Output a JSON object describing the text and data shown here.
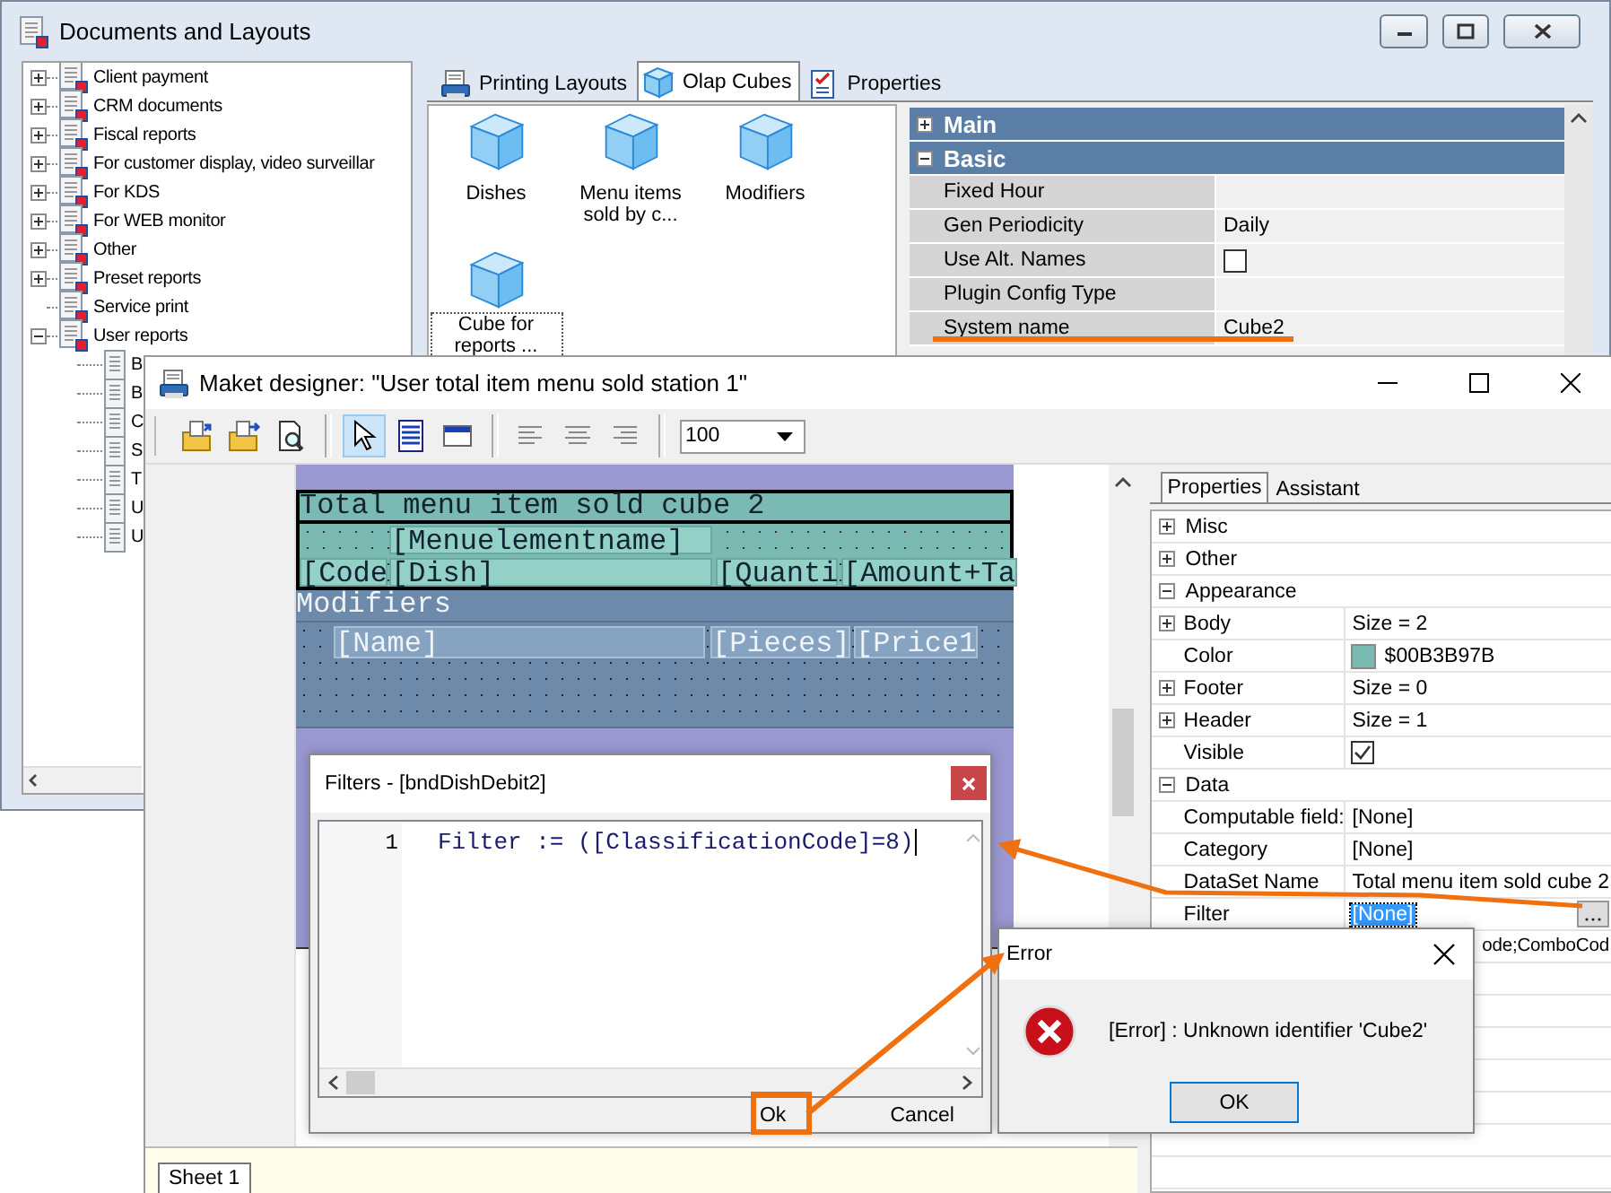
{
  "documents_window": {
    "title": "Documents and Layouts",
    "tree": [
      {
        "label": "Client payment",
        "expanded": false
      },
      {
        "label": "CRM documents",
        "expanded": false
      },
      {
        "label": "Fiscal reports",
        "expanded": false
      },
      {
        "label": "For customer display, video surveillar",
        "expanded": false
      },
      {
        "label": "For KDS",
        "expanded": false
      },
      {
        "label": "For WEB monitor",
        "expanded": false
      },
      {
        "label": "Other",
        "expanded": false
      },
      {
        "label": "Preset reports",
        "expanded": false
      },
      {
        "label": "Service print"
      },
      {
        "label": "User reports",
        "expanded": true,
        "children": [
          {
            "label": "B"
          },
          {
            "label": "B"
          },
          {
            "label": "C"
          },
          {
            "label": "S"
          },
          {
            "label": "T"
          },
          {
            "label": "U"
          },
          {
            "label": "U"
          }
        ]
      }
    ],
    "tabs": [
      {
        "label": "Printing Layouts",
        "selected": false
      },
      {
        "label": "Olap Cubes",
        "selected": true
      },
      {
        "label": "Properties",
        "selected": false
      }
    ],
    "cubes": [
      {
        "label": "Dishes",
        "selected": false
      },
      {
        "label": "Menu items sold by c...",
        "selected": false
      },
      {
        "label": "Modifiers",
        "selected": false
      },
      {
        "label": "Cube for reports ...",
        "selected": true
      }
    ],
    "property_grid": [
      {
        "kind": "section",
        "label": "Main",
        "expanded": false
      },
      {
        "kind": "section",
        "label": "Basic",
        "expanded": true
      },
      {
        "kind": "text",
        "label": "Fixed Hour"
      },
      {
        "kind": "text",
        "label": "Gen Periodicity",
        "value": "Daily"
      },
      {
        "kind": "checkbox",
        "label": "Use Alt. Names",
        "checked": false
      },
      {
        "kind": "text",
        "label": "Plugin Config Type"
      },
      {
        "kind": "text",
        "label": "System name",
        "value": "Cube2"
      }
    ]
  },
  "designer_window": {
    "title": "Maket designer: \"User total item menu sold station 1\"",
    "toolbar": [
      {
        "kind": "open",
        "selected": false
      },
      {
        "kind": "save",
        "selected": false
      },
      {
        "kind": "preview",
        "selected": false
      },
      {
        "kind": "pointer",
        "selected": true
      },
      {
        "kind": "band",
        "selected": false
      },
      {
        "kind": "frame",
        "selected": false
      },
      {
        "kind": "align_left",
        "selected": false
      },
      {
        "kind": "align_center",
        "selected": false
      },
      {
        "kind": "align_right",
        "selected": false
      }
    ],
    "zoom": "100",
    "bands": [
      {
        "kind": "header",
        "text": "Total menu item sold cube 2"
      },
      {
        "kind": "master",
        "fields": [
          "[Menuelementname]",
          "[Code",
          "[Dish]",
          "[Quanti",
          "[Amount+Ta"
        ]
      },
      {
        "kind": "group_header",
        "text": "Modifiers"
      },
      {
        "kind": "detail",
        "fields": [
          "[Name]",
          "[Pieces]",
          "[Price1"
        ]
      }
    ],
    "panel_tabs": [
      {
        "label": "Properties",
        "selected": true
      },
      {
        "label": "Assistant",
        "selected": false
      }
    ],
    "properties": [
      {
        "kind": "section",
        "label": "Misc",
        "expanded": false
      },
      {
        "kind": "section",
        "label": "Other",
        "expanded": false
      },
      {
        "kind": "section",
        "label": "Appearance",
        "expanded": true
      },
      {
        "kind": "group",
        "label": "Body",
        "expanded": false,
        "value": "Size = 2",
        "selected": false
      },
      {
        "kind": "color",
        "label": "Color",
        "value": "$00B3B97B",
        "color": "#7bb9b3",
        "selected": false
      },
      {
        "kind": "group",
        "label": "Footer",
        "expanded": false,
        "value": "Size = 0",
        "selected": false
      },
      {
        "kind": "group",
        "label": "Header",
        "expanded": false,
        "value": "Size = 1",
        "selected": false
      },
      {
        "kind": "checkbox",
        "label": "Visible",
        "checked": true,
        "selected": false
      },
      {
        "kind": "section",
        "label": "Data",
        "expanded": true
      },
      {
        "kind": "text",
        "label": "Computable field:",
        "value": "[None]",
        "selected": false
      },
      {
        "kind": "text",
        "label": "Category",
        "value": "[None]",
        "selected": false
      },
      {
        "kind": "text",
        "label": "DataSet Name",
        "value": "Total menu item sold cube 2",
        "selected": false
      },
      {
        "kind": "text",
        "label": "Filter",
        "value": "[None]",
        "selected": true,
        "has_button": true
      },
      {
        "kind": "text",
        "value": "ode;ComboCod",
        "selected": false
      }
    ],
    "sheet_tabs": [
      {
        "label": "Sheet 1",
        "selected": true
      }
    ]
  },
  "filters_dialog": {
    "title": "Filters - [bndDishDebit2]",
    "lines": [
      {
        "number": "1",
        "code": "Filter := ([ClassificationCode]=8)"
      }
    ],
    "buttons": [
      "Ok",
      "Cancel"
    ]
  },
  "error_dialog": {
    "title": "Error",
    "message": "[Error] : Unknown identifier 'Cube2'",
    "button": "OK"
  }
}
